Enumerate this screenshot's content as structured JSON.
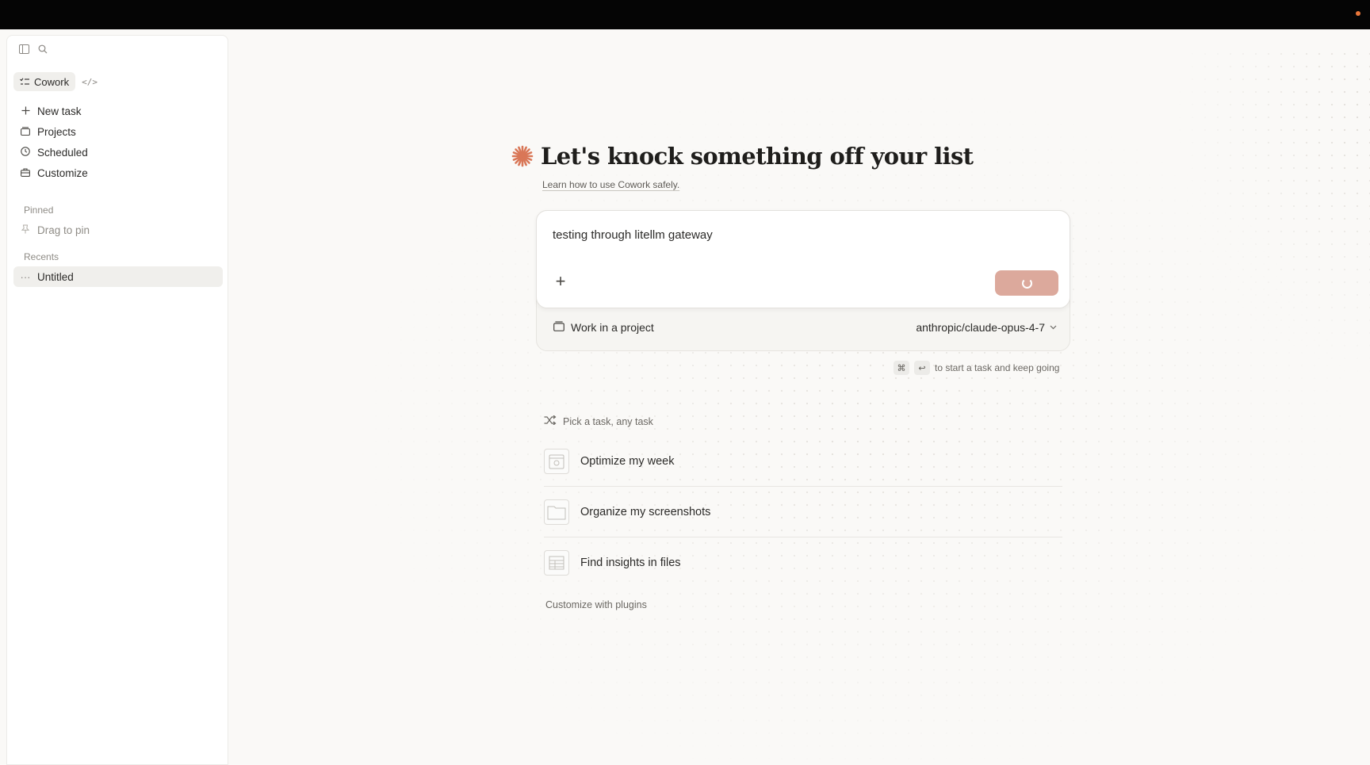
{
  "sidebar": {
    "top_icons": [
      "sidebar-toggle-icon",
      "search-icon"
    ],
    "modes": {
      "active": "Cowork",
      "code_icon": "</>"
    },
    "nav": [
      {
        "label": "New task",
        "icon": "plus-icon"
      },
      {
        "label": "Projects",
        "icon": "folder-icon"
      },
      {
        "label": "Scheduled",
        "icon": "clock-icon"
      },
      {
        "label": "Customize",
        "icon": "briefcase-icon"
      }
    ],
    "pinned_label": "Pinned",
    "drag_to_pin": "Drag to pin",
    "recents_label": "Recents",
    "recents": [
      {
        "label": "Untitled"
      }
    ]
  },
  "main": {
    "title": "Let's knock something off your list",
    "learn_link": "Learn how to use Cowork safely.",
    "composer": {
      "text": "testing through litellm gateway",
      "add_icon": "+",
      "send_state": "loading"
    },
    "project_label": "Work in a project",
    "model_label": "anthropic/claude-opus-4-7",
    "shortcut": {
      "keys": [
        "⌘",
        "↩"
      ],
      "text": "to start a task and keep going"
    },
    "pick_label": "Pick a task, any task",
    "tasks": [
      {
        "label": "Optimize my week",
        "icon": "calendar-icon"
      },
      {
        "label": "Organize my screenshots",
        "icon": "folder-icon"
      },
      {
        "label": "Find insights in files",
        "icon": "spreadsheet-icon"
      }
    ],
    "customize_plugins": "Customize with plugins"
  },
  "colors": {
    "accent": "#d97757",
    "send_button": "#dca99c",
    "background": "#faf9f7",
    "topbar": "#050505",
    "status_dot": "#e8763a"
  }
}
